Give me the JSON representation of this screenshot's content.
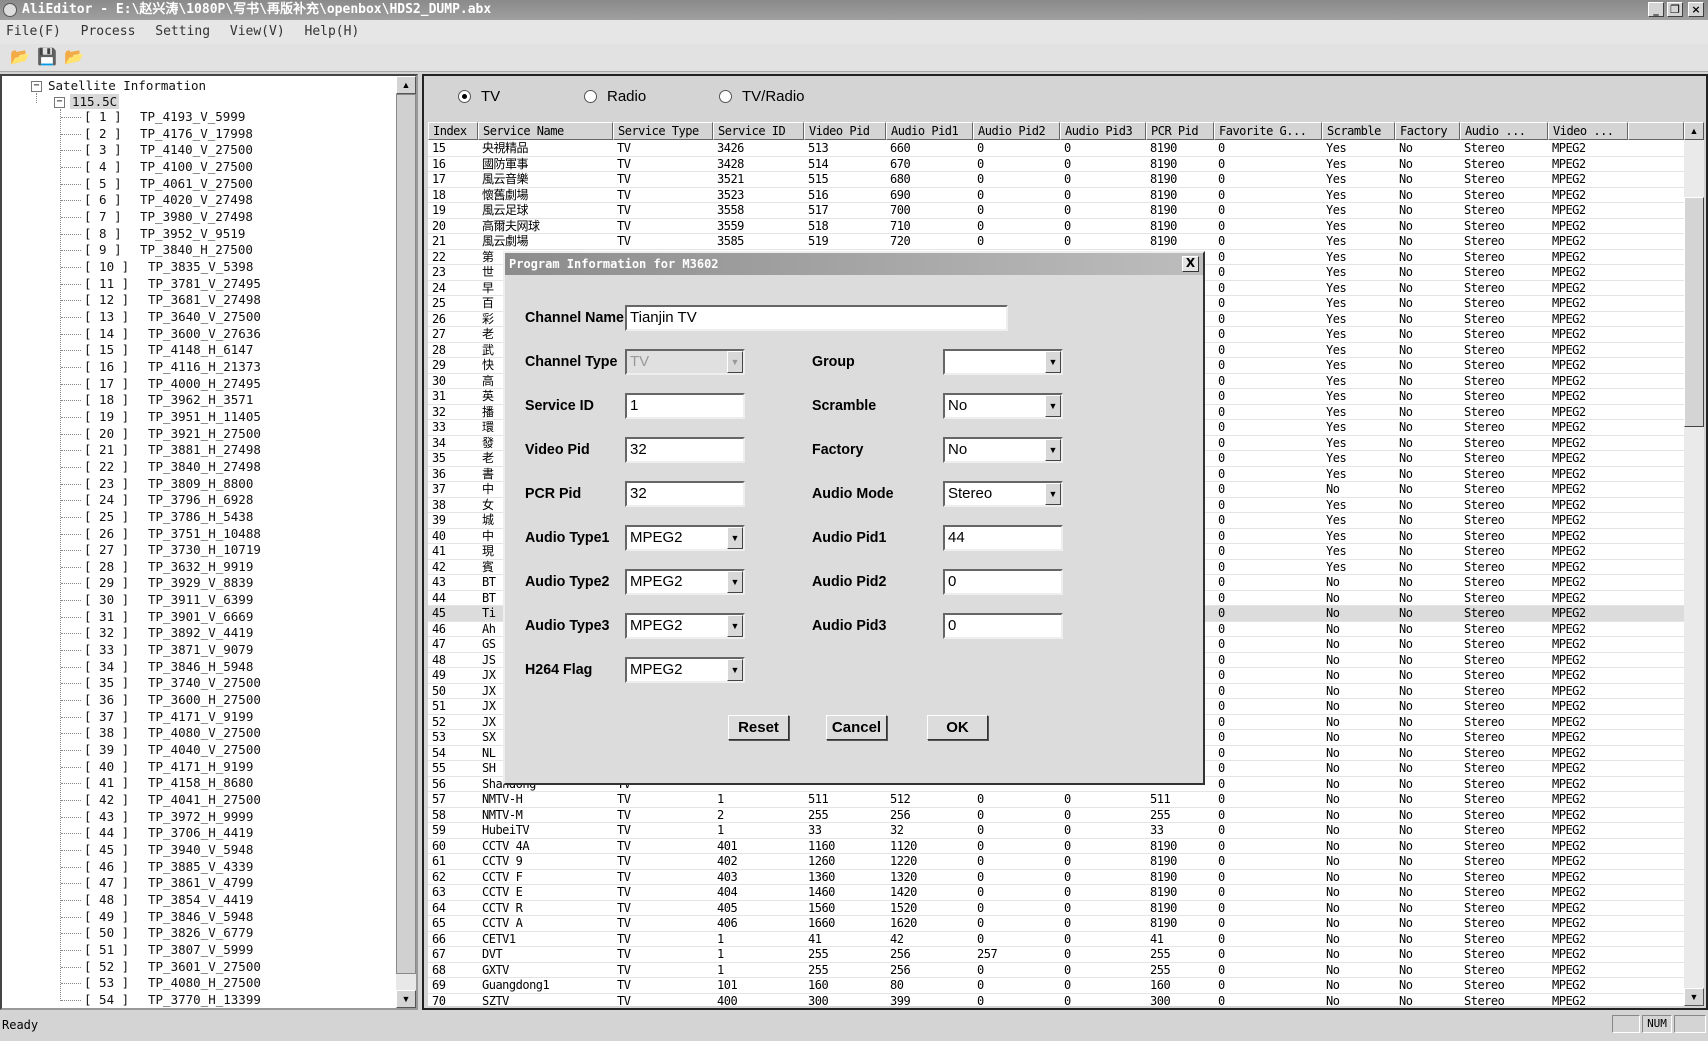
{
  "window": {
    "title": "AliEditor - E:\\赵兴涛\\1080P\\写书\\再版补充\\openbox\\HDS2_DUMP.abx"
  },
  "menu": [
    "File(F)",
    "Process",
    "Setting",
    "View(V)",
    "Help(H)"
  ],
  "tree": {
    "root": "Satellite Information",
    "satellite": "115.5C",
    "items": [
      "TP_4193_V_5999",
      "TP_4176_V_17998",
      "TP_4140_V_27500",
      "TP_4100_V_27500",
      "TP_4061_V_27500",
      "TP_4020_V_27498",
      "TP_3980_V_27498",
      "TP_3952_V_9519",
      "TP_3840_H_27500",
      "TP_3835_V_5398",
      "TP_3781_V_27495",
      "TP_3681_V_27498",
      "TP_3640_V_27500",
      "TP_3600_V_27636",
      "TP_4148_H_6147",
      "TP_4116_H_21373",
      "TP_4000_H_27495",
      "TP_3962_H_3571",
      "TP_3951_H_11405",
      "TP_3921_H_27500",
      "TP_3881_H_27498",
      "TP_3840_H_27498",
      "TP_3809_H_8800",
      "TP_3796_H_6928",
      "TP_3786_H_5438",
      "TP_3751_H_10488",
      "TP_3730_H_10719",
      "TP_3632_H_9919",
      "TP_3929_V_8839",
      "TP_3911_V_6399",
      "TP_3901_V_6669",
      "TP_3892_V_4419",
      "TP_3871_V_9079",
      "TP_3846_H_5948",
      "TP_3740_V_27500",
      "TP_3600_H_27500",
      "TP_4171_V_9199",
      "TP_4080_V_27500",
      "TP_4040_V_27500",
      "TP_4171_H_9199",
      "TP_4158_H_8680",
      "TP_4041_H_27500",
      "TP_3972_H_9999",
      "TP_3706_H_4419",
      "TP_3940_V_5948",
      "TP_3885_V_4339",
      "TP_3861_V_4799",
      "TP_3854_V_4419",
      "TP_3846_V_5948",
      "TP_3826_V_6779",
      "TP_3807_V_5999",
      "TP_3601_V_27500",
      "TP_4080_H_27500",
      "TP_3770_H_13399"
    ]
  },
  "filter": {
    "options": [
      "TV",
      "Radio",
      "TV/Radio"
    ],
    "selected": "TV"
  },
  "table": {
    "columns": [
      "Index",
      "Service Name",
      "Service Type",
      "Service ID",
      "Video Pid",
      "Audio Pid1",
      "Audio Pid2",
      "Audio Pid3",
      "PCR Pid",
      "Favorite G...",
      "Scramble",
      "Factory",
      "Audio ...",
      "Video ..."
    ],
    "selected_index": "45",
    "rows": [
      [
        "15",
        "央視精品",
        "TV",
        "3426",
        "513",
        "660",
        "0",
        "0",
        "8190",
        "0",
        "Yes",
        "No",
        "Stereo",
        "MPEG2"
      ],
      [
        "16",
        "國防軍事",
        "TV",
        "3428",
        "514",
        "670",
        "0",
        "0",
        "8190",
        "0",
        "Yes",
        "No",
        "Stereo",
        "MPEG2"
      ],
      [
        "17",
        "風云音樂",
        "TV",
        "3521",
        "515",
        "680",
        "0",
        "0",
        "8190",
        "0",
        "Yes",
        "No",
        "Stereo",
        "MPEG2"
      ],
      [
        "18",
        "懷舊劇場",
        "TV",
        "3523",
        "516",
        "690",
        "0",
        "0",
        "8190",
        "0",
        "Yes",
        "No",
        "Stereo",
        "MPEG2"
      ],
      [
        "19",
        "風云足球",
        "TV",
        "3558",
        "517",
        "700",
        "0",
        "0",
        "8190",
        "0",
        "Yes",
        "No",
        "Stereo",
        "MPEG2"
      ],
      [
        "20",
        "高爾夫网球",
        "TV",
        "3559",
        "518",
        "710",
        "0",
        "0",
        "8190",
        "0",
        "Yes",
        "No",
        "Stereo",
        "MPEG2"
      ],
      [
        "21",
        "風云劇場",
        "TV",
        "3585",
        "519",
        "720",
        "0",
        "0",
        "8190",
        "0",
        "Yes",
        "No",
        "Stereo",
        "MPEG2"
      ],
      [
        "22",
        "第",
        "",
        "",
        "",
        "",
        "",
        "",
        "",
        "0",
        "Yes",
        "No",
        "Stereo",
        "MPEG2"
      ],
      [
        "23",
        "世",
        "",
        "",
        "",
        "",
        "",
        "",
        "",
        "0",
        "Yes",
        "No",
        "Stereo",
        "MPEG2"
      ],
      [
        "24",
        "早",
        "",
        "",
        "",
        "",
        "",
        "",
        "",
        "0",
        "Yes",
        "No",
        "Stereo",
        "MPEG2"
      ],
      [
        "25",
        "百",
        "",
        "",
        "",
        "",
        "",
        "",
        "",
        "0",
        "Yes",
        "No",
        "Stereo",
        "MPEG2"
      ],
      [
        "26",
        "彩",
        "",
        "",
        "",
        "",
        "",
        "",
        "",
        "0",
        "Yes",
        "No",
        "Stereo",
        "MPEG2"
      ],
      [
        "27",
        "老",
        "",
        "",
        "",
        "",
        "",
        "",
        "",
        "0",
        "Yes",
        "No",
        "Stereo",
        "MPEG2"
      ],
      [
        "28",
        "武",
        "",
        "",
        "",
        "",
        "",
        "",
        "",
        "0",
        "Yes",
        "No",
        "Stereo",
        "MPEG2"
      ],
      [
        "29",
        "快",
        "",
        "",
        "",
        "",
        "",
        "",
        "",
        "0",
        "Yes",
        "No",
        "Stereo",
        "MPEG2"
      ],
      [
        "30",
        "高",
        "",
        "",
        "",
        "",
        "",
        "",
        "",
        "0",
        "Yes",
        "No",
        "Stereo",
        "MPEG2"
      ],
      [
        "31",
        "英",
        "",
        "",
        "",
        "",
        "",
        "",
        "",
        "0",
        "Yes",
        "No",
        "Stereo",
        "MPEG2"
      ],
      [
        "32",
        "播",
        "",
        "",
        "",
        "",
        "",
        "",
        "",
        "0",
        "Yes",
        "No",
        "Stereo",
        "MPEG2"
      ],
      [
        "33",
        "環",
        "",
        "",
        "",
        "",
        "",
        "",
        "",
        "0",
        "Yes",
        "No",
        "Stereo",
        "MPEG2"
      ],
      [
        "34",
        "發",
        "",
        "",
        "",
        "",
        "",
        "",
        "",
        "0",
        "Yes",
        "No",
        "Stereo",
        "MPEG2"
      ],
      [
        "35",
        "老",
        "",
        "",
        "",
        "",
        "",
        "",
        "",
        "0",
        "Yes",
        "No",
        "Stereo",
        "MPEG2"
      ],
      [
        "36",
        "書",
        "",
        "",
        "",
        "",
        "",
        "",
        "",
        "0",
        "Yes",
        "No",
        "Stereo",
        "MPEG2"
      ],
      [
        "37",
        "中",
        "",
        "",
        "",
        "",
        "",
        "",
        "",
        "0",
        "No",
        "No",
        "Stereo",
        "MPEG2"
      ],
      [
        "38",
        "女",
        "",
        "",
        "",
        "",
        "",
        "",
        "",
        "0",
        "Yes",
        "No",
        "Stereo",
        "MPEG2"
      ],
      [
        "39",
        "城",
        "",
        "",
        "",
        "",
        "",
        "",
        "",
        "0",
        "Yes",
        "No",
        "Stereo",
        "MPEG2"
      ],
      [
        "40",
        "中",
        "",
        "",
        "",
        "",
        "",
        "",
        "",
        "0",
        "Yes",
        "No",
        "Stereo",
        "MPEG2"
      ],
      [
        "41",
        "現",
        "",
        "",
        "",
        "",
        "",
        "",
        "",
        "0",
        "Yes",
        "No",
        "Stereo",
        "MPEG2"
      ],
      [
        "42",
        "賓",
        "",
        "",
        "",
        "",
        "",
        "",
        "",
        "0",
        "Yes",
        "No",
        "Stereo",
        "MPEG2"
      ],
      [
        "43",
        "BT",
        "",
        "",
        "",
        "",
        "",
        "",
        "",
        "0",
        "No",
        "No",
        "Stereo",
        "MPEG2"
      ],
      [
        "44",
        "BT",
        "",
        "",
        "",
        "",
        "",
        "",
        "",
        "0",
        "No",
        "No",
        "Stereo",
        "MPEG2"
      ],
      [
        "45",
        "Ti",
        "",
        "",
        "",
        "",
        "",
        "",
        "",
        "0",
        "No",
        "No",
        "Stereo",
        "MPEG2"
      ],
      [
        "46",
        "Ah",
        "",
        "",
        "",
        "",
        "",
        "",
        "",
        "0",
        "No",
        "No",
        "Stereo",
        "MPEG2"
      ],
      [
        "47",
        "GS",
        "",
        "",
        "",
        "",
        "",
        "",
        "",
        "0",
        "No",
        "No",
        "Stereo",
        "MPEG2"
      ],
      [
        "48",
        "JS",
        "",
        "",
        "",
        "",
        "",
        "",
        "",
        "0",
        "No",
        "No",
        "Stereo",
        "MPEG2"
      ],
      [
        "49",
        "JX",
        "",
        "",
        "",
        "",
        "",
        "",
        "",
        "0",
        "No",
        "No",
        "Stereo",
        "MPEG2"
      ],
      [
        "50",
        "JX",
        "",
        "",
        "",
        "",
        "",
        "",
        "",
        "0",
        "No",
        "No",
        "Stereo",
        "MPEG2"
      ],
      [
        "51",
        "JX",
        "",
        "",
        "",
        "",
        "",
        "",
        "",
        "0",
        "No",
        "No",
        "Stereo",
        "MPEG2"
      ],
      [
        "52",
        "JX",
        "",
        "",
        "",
        "",
        "",
        "",
        "",
        "0",
        "No",
        "No",
        "Stereo",
        "MPEG2"
      ],
      [
        "53",
        "SX",
        "",
        "",
        "",
        "",
        "",
        "",
        "",
        "0",
        "No",
        "No",
        "Stereo",
        "MPEG2"
      ],
      [
        "54",
        "NL",
        "",
        "",
        "",
        "",
        "",
        "",
        "",
        "0",
        "No",
        "No",
        "Stereo",
        "MPEG2"
      ],
      [
        "55",
        "SH",
        "",
        "",
        "",
        "",
        "",
        "",
        "",
        "0",
        "No",
        "No",
        "Stereo",
        "MPEG2"
      ],
      [
        "56",
        "Shandong",
        "TV",
        "",
        "",
        "",
        "",
        "",
        "",
        "0",
        "No",
        "No",
        "Stereo",
        "MPEG2"
      ],
      [
        "57",
        "NMTV-H",
        "TV",
        "1",
        "511",
        "512",
        "0",
        "0",
        "511",
        "0",
        "No",
        "No",
        "Stereo",
        "MPEG2"
      ],
      [
        "58",
        "NMTV-M",
        "TV",
        "2",
        "255",
        "256",
        "0",
        "0",
        "255",
        "0",
        "No",
        "No",
        "Stereo",
        "MPEG2"
      ],
      [
        "59",
        "HubeiTV",
        "TV",
        "1",
        "33",
        "32",
        "0",
        "0",
        "33",
        "0",
        "No",
        "No",
        "Stereo",
        "MPEG2"
      ],
      [
        "60",
        "CCTV 4A",
        "TV",
        "401",
        "1160",
        "1120",
        "0",
        "0",
        "8190",
        "0",
        "No",
        "No",
        "Stereo",
        "MPEG2"
      ],
      [
        "61",
        "CCTV 9",
        "TV",
        "402",
        "1260",
        "1220",
        "0",
        "0",
        "8190",
        "0",
        "No",
        "No",
        "Stereo",
        "MPEG2"
      ],
      [
        "62",
        "CCTV F",
        "TV",
        "403",
        "1360",
        "1320",
        "0",
        "0",
        "8190",
        "0",
        "No",
        "No",
        "Stereo",
        "MPEG2"
      ],
      [
        "63",
        "CCTV E",
        "TV",
        "404",
        "1460",
        "1420",
        "0",
        "0",
        "8190",
        "0",
        "No",
        "No",
        "Stereo",
        "MPEG2"
      ],
      [
        "64",
        "CCTV R",
        "TV",
        "405",
        "1560",
        "1520",
        "0",
        "0",
        "8190",
        "0",
        "No",
        "No",
        "Stereo",
        "MPEG2"
      ],
      [
        "65",
        "CCTV A",
        "TV",
        "406",
        "1660",
        "1620",
        "0",
        "0",
        "8190",
        "0",
        "No",
        "No",
        "Stereo",
        "MPEG2"
      ],
      [
        "66",
        "CETV1",
        "TV",
        "1",
        "41",
        "42",
        "0",
        "0",
        "41",
        "0",
        "No",
        "No",
        "Stereo",
        "MPEG2"
      ],
      [
        "67",
        "DVT",
        "TV",
        "1",
        "255",
        "256",
        "257",
        "0",
        "255",
        "0",
        "No",
        "No",
        "Stereo",
        "MPEG2"
      ],
      [
        "68",
        "GXTV",
        "TV",
        "1",
        "255",
        "256",
        "0",
        "0",
        "255",
        "0",
        "No",
        "No",
        "Stereo",
        "MPEG2"
      ],
      [
        "69",
        "Guangdong1",
        "TV",
        "101",
        "160",
        "80",
        "0",
        "0",
        "160",
        "0",
        "No",
        "No",
        "Stereo",
        "MPEG2"
      ],
      [
        "70",
        "SZTV",
        "TV",
        "400",
        "300",
        "399",
        "0",
        "0",
        "300",
        "0",
        "No",
        "No",
        "Stereo",
        "MPEG2"
      ]
    ]
  },
  "dialog": {
    "title": "Program Information for M3602",
    "channel_name": {
      "label": "Channel Name",
      "value": "Tianjin TV"
    },
    "channel_type": {
      "label": "Channel Type",
      "value": "TV"
    },
    "service_id": {
      "label": "Service ID",
      "value": "1"
    },
    "video_pid": {
      "label": "Video Pid",
      "value": "32"
    },
    "pcr_pid": {
      "label": "PCR Pid",
      "value": "32"
    },
    "audio_type1": {
      "label": "Audio Type1",
      "value": "MPEG2"
    },
    "audio_type2": {
      "label": "Audio Type2",
      "value": "MPEG2"
    },
    "audio_type3": {
      "label": "Audio Type3",
      "value": "MPEG2"
    },
    "h264_flag": {
      "label": "H264 Flag",
      "value": "MPEG2"
    },
    "group": {
      "label": "Group",
      "value": ""
    },
    "scramble": {
      "label": "Scramble",
      "value": "No"
    },
    "factory": {
      "label": "Factory",
      "value": "No"
    },
    "audio_mode": {
      "label": "Audio Mode",
      "value": "Stereo"
    },
    "audio_pid1": {
      "label": "Audio Pid1",
      "value": "44"
    },
    "audio_pid2": {
      "label": "Audio Pid2",
      "value": "0"
    },
    "audio_pid3": {
      "label": "Audio Pid3",
      "value": "0"
    },
    "buttons": {
      "reset": "Reset",
      "cancel": "Cancel",
      "ok": "OK"
    }
  },
  "status": {
    "text": "Ready",
    "num": "NUM"
  }
}
